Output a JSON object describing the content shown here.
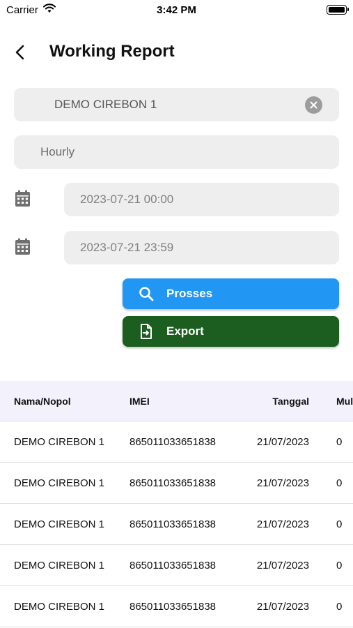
{
  "status_bar": {
    "carrier": "Carrier",
    "time": "3:42 PM"
  },
  "header": {
    "title": "Working Report"
  },
  "form": {
    "vehicle": "DEMO CIREBON 1",
    "period": "Hourly",
    "start_datetime": "2023-07-21 00:00",
    "end_datetime": "2023-07-21 23:59"
  },
  "buttons": {
    "process_label": "Prosses",
    "export_label": "Export"
  },
  "colors": {
    "process": "#2196f3",
    "export": "#1b5e20",
    "header_row": "#f3f1fb"
  },
  "table": {
    "headers": [
      "Nama/Nopol",
      "IMEI",
      "Tanggal",
      "Mul"
    ],
    "rows": [
      [
        "DEMO CIREBON 1",
        "865011033651838",
        "21/07/2023",
        "0"
      ],
      [
        "DEMO CIREBON 1",
        "865011033651838",
        "21/07/2023",
        "0"
      ],
      [
        "DEMO CIREBON 1",
        "865011033651838",
        "21/07/2023",
        "0"
      ],
      [
        "DEMO CIREBON 1",
        "865011033651838",
        "21/07/2023",
        "0"
      ],
      [
        "DEMO CIREBON 1",
        "865011033651838",
        "21/07/2023",
        "0"
      ]
    ]
  }
}
